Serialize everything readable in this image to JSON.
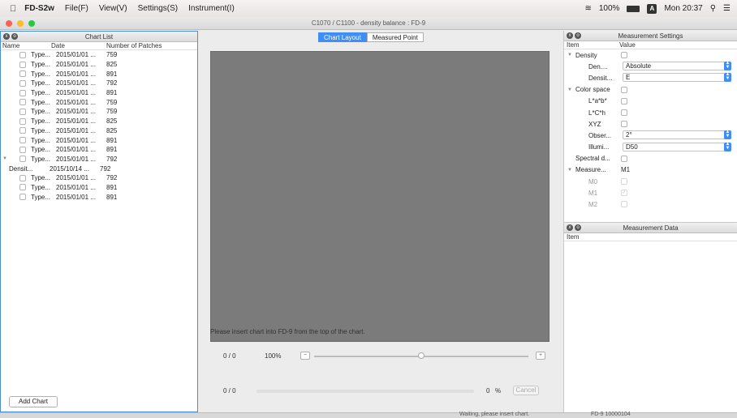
{
  "menubar": {
    "app": "FD-S2w",
    "items": [
      "File(F)",
      "View(V)",
      "Settings(S)",
      "Instrument(I)"
    ],
    "battery": "100%",
    "input_label": "A",
    "clock": "Mon 20:37"
  },
  "window": {
    "title": "C1070 / C1100 - density balance : FD-9"
  },
  "chart_list": {
    "title": "Chart List",
    "columns": [
      "Name",
      "Date",
      "Number of Patches"
    ],
    "rows": [
      {
        "name": "Type...",
        "date": "2015/01/01 ...",
        "patches": "759"
      },
      {
        "name": "Type...",
        "date": "2015/01/01 ...",
        "patches": "825"
      },
      {
        "name": "Type...",
        "date": "2015/01/01 ...",
        "patches": "891"
      },
      {
        "name": "Type...",
        "date": "2015/01/01 ...",
        "patches": "792"
      },
      {
        "name": "Type...",
        "date": "2015/01/01 ...",
        "patches": "891"
      },
      {
        "name": "Type...",
        "date": "2015/01/01 ...",
        "patches": "759"
      },
      {
        "name": "Type...",
        "date": "2015/01/01 ...",
        "patches": "759"
      },
      {
        "name": "Type...",
        "date": "2015/01/01 ...",
        "patches": "825"
      },
      {
        "name": "Type...",
        "date": "2015/01/01 ...",
        "patches": "825"
      },
      {
        "name": "Type...",
        "date": "2015/01/01 ...",
        "patches": "891"
      },
      {
        "name": "Type...",
        "date": "2015/01/01 ...",
        "patches": "891"
      },
      {
        "name": "Type...",
        "date": "2015/01/01 ...",
        "patches": "792",
        "expanded": true
      },
      {
        "name": "Densit...",
        "date": "2015/10/14 ...",
        "patches": "792",
        "child": true
      },
      {
        "name": "Type...",
        "date": "2015/01/01 ...",
        "patches": "792"
      },
      {
        "name": "Type...",
        "date": "2015/01/01 ...",
        "patches": "891"
      },
      {
        "name": "Type...",
        "date": "2015/01/01 ...",
        "patches": "891"
      }
    ],
    "add_button": "Add Chart"
  },
  "center": {
    "tabs": [
      "Chart Layout",
      "Measured Point"
    ],
    "message": "Please insert chart into FD-9 from the top of the chart.",
    "counter1": "0 / 0",
    "zoom": "100%",
    "zoom_level": 0.5,
    "counter2": "0 / 0",
    "progress_value": "0",
    "progress_unit": "%",
    "cancel": "Cancel"
  },
  "settings": {
    "title": "Measurement Settings",
    "columns": [
      "Item",
      "Value"
    ],
    "rows": [
      {
        "label": "Density",
        "type": "group-check"
      },
      {
        "label": "Den....",
        "type": "select",
        "value": "Absolute"
      },
      {
        "label": "Densit...",
        "type": "select",
        "value": "E"
      },
      {
        "label": "Color space",
        "type": "group-check"
      },
      {
        "label": "L*a*b*",
        "type": "check"
      },
      {
        "label": "L*C*h",
        "type": "check"
      },
      {
        "label": "XYZ",
        "type": "check"
      },
      {
        "label": "Obser...",
        "type": "select",
        "value": "2°"
      },
      {
        "label": "Illumi...",
        "type": "select",
        "value": "D50"
      },
      {
        "label": "Spectral d...",
        "type": "check-left"
      },
      {
        "label": "Measure...",
        "type": "group-text",
        "value": "M1"
      },
      {
        "label": "M0",
        "type": "check-gray"
      },
      {
        "label": "M1",
        "type": "check-gray-on"
      },
      {
        "label": "M2",
        "type": "check-gray"
      }
    ]
  },
  "measurement_data": {
    "title": "Measurement Data",
    "column": "Item"
  },
  "status": {
    "left": "Waiting, please insert chart.",
    "right": "FD-9 10000104"
  },
  "colors": {
    "accent": "#3f8ef7",
    "canvas": "#7b7b7b",
    "close": "#fc5f57",
    "minimize": "#fdbc2e",
    "zoom": "#28c840"
  }
}
